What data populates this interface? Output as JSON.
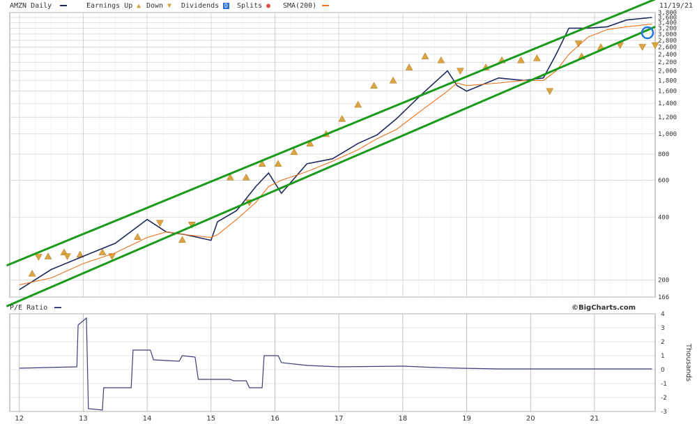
{
  "header": {
    "ticker": "AMZN Daily",
    "earnings_up": "Earnings Up",
    "earnings_down": "Down",
    "dividends": "Dividends",
    "splits": "Splits",
    "sma": "SMA(200)",
    "date": "11/19/21"
  },
  "lower_panel": {
    "label": "P/E Ratio",
    "credit": "©BigCharts.com",
    "ylabel": "Thousands"
  },
  "colors": {
    "price": "#1f2a5c",
    "sma": "#e8731e",
    "channel": "#1a9a1a",
    "earnings_up": "#d9a441",
    "highlight": "#2277dd",
    "grid": "#c8c8c8",
    "pe": "#3b3f7a"
  },
  "chart_data": [
    {
      "type": "line",
      "title": "AMZN Daily",
      "scale": "log",
      "x": [
        2012.0,
        2012.5,
        2013.0,
        2013.5,
        2014.0,
        2014.3,
        2014.6,
        2015.0,
        2015.1,
        2015.4,
        2015.7,
        2015.9,
        2016.1,
        2016.5,
        2016.9,
        2017.3,
        2017.6,
        2017.9,
        2018.3,
        2018.7,
        2018.85,
        2019.0,
        2019.5,
        2019.9,
        2020.2,
        2020.4,
        2020.6,
        2020.9,
        2021.2,
        2021.5,
        2021.9
      ],
      "series": [
        {
          "name": "AMZN Daily",
          "values": [
            180,
            225,
            260,
            300,
            390,
            340,
            330,
            310,
            380,
            430,
            560,
            650,
            520,
            720,
            760,
            900,
            990,
            1180,
            1550,
            2000,
            1700,
            1600,
            1850,
            1800,
            1850,
            2400,
            3200,
            3200,
            3250,
            3500,
            3600
          ]
        },
        {
          "name": "SMA(200)",
          "values": [
            190,
            205,
            240,
            270,
            320,
            340,
            330,
            320,
            330,
            390,
            470,
            560,
            600,
            660,
            740,
            840,
            950,
            1050,
            1300,
            1600,
            1750,
            1700,
            1750,
            1800,
            1800,
            2000,
            2400,
            2900,
            3150,
            3250,
            3350
          ]
        }
      ],
      "channel_lines": [
        {
          "x": [
            2011.8,
            2021.95
          ],
          "values": [
            235,
            4400
          ]
        },
        {
          "x": [
            2011.8,
            2021.95
          ],
          "values": [
            150,
            3250
          ]
        }
      ],
      "earnings_up_markers": {
        "x": [
          2012.2,
          2012.45,
          2012.7,
          2012.95,
          2013.3,
          2013.85,
          2014.55,
          2015.3,
          2015.55,
          2015.8,
          2016.05,
          2016.3,
          2016.55,
          2016.8,
          2017.05,
          2017.3,
          2017.55,
          2017.85,
          2018.1,
          2018.35,
          2018.6,
          2019.3,
          2019.55,
          2019.85,
          2020.1,
          2020.8,
          2021.1
        ],
        "values": [
          215,
          260,
          272,
          265,
          272,
          322,
          312,
          620,
          620,
          720,
          720,
          820,
          900,
          1000,
          1180,
          1380,
          1700,
          1800,
          2080,
          2350,
          2250,
          2080,
          2250,
          2250,
          2300,
          2350,
          2600
        ]
      },
      "earnings_down_markers": {
        "x": [
          2012.3,
          2012.75,
          2013.45,
          2014.2,
          2014.7,
          2015.6,
          2018.9,
          2020.3,
          2020.75,
          2021.4,
          2021.75,
          2021.95
        ],
        "values": [
          258,
          260,
          260,
          375,
          368,
          470,
          2000,
          1600,
          2700,
          2650,
          2600,
          2650
        ]
      },
      "yticks": [
        166,
        200,
        400,
        600,
        800,
        1000,
        1200,
        1400,
        1600,
        1800,
        2000,
        2200,
        2400,
        2600,
        2800,
        3000,
        3200,
        3400,
        3600,
        3800
      ],
      "ylim": [
        166,
        3800
      ],
      "xlim": [
        2011.85,
        2021.95
      ],
      "grid": true,
      "legend": "top"
    },
    {
      "type": "line",
      "title": "P/E Ratio",
      "ylabel": "Thousands",
      "x": [
        2012.0,
        2012.9,
        2012.92,
        2013.05,
        2013.08,
        2013.3,
        2013.32,
        2013.75,
        2013.78,
        2014.05,
        2014.1,
        2014.5,
        2014.55,
        2014.75,
        2014.8,
        2015.3,
        2015.35,
        2015.55,
        2015.6,
        2015.8,
        2015.83,
        2016.05,
        2016.1,
        2016.5,
        2017.0,
        2018.0,
        2018.5,
        2018.9,
        2019.5,
        2020.5,
        2021.0,
        2021.9
      ],
      "series": [
        {
          "name": "P/E Ratio",
          "values": [
            0.1,
            0.2,
            3.2,
            3.7,
            -2.8,
            -2.9,
            -1.3,
            -1.3,
            1.4,
            1.4,
            0.7,
            0.6,
            1.0,
            0.9,
            -0.7,
            -0.7,
            -0.8,
            -0.8,
            -1.3,
            -1.3,
            1.0,
            1.0,
            0.5,
            0.3,
            0.2,
            0.25,
            0.15,
            0.1,
            0.05,
            0.05,
            0.05,
            0.05
          ]
        }
      ],
      "yticks": [
        -3,
        -2,
        -1,
        0,
        1,
        2,
        3,
        4
      ],
      "ylim": [
        -3,
        4
      ],
      "xticks": [
        "12",
        "13",
        "14",
        "15",
        "16",
        "17",
        "18",
        "19",
        "20",
        "21"
      ],
      "grid": true
    }
  ]
}
